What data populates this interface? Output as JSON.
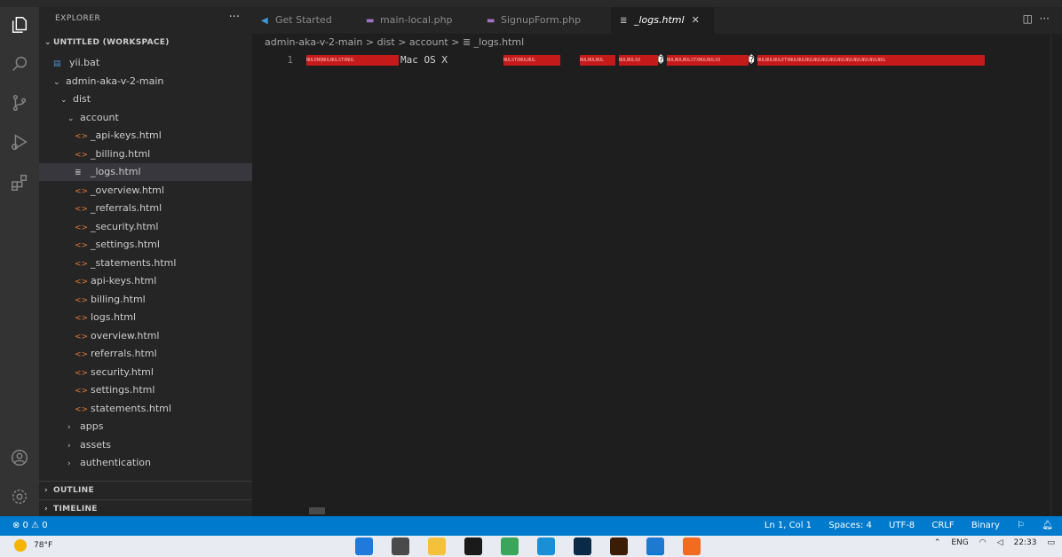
{
  "sidebar": {
    "title": "EXPLORER",
    "more": "···",
    "workspace": "UNTITLED (WORKSPACE)",
    "items": [
      {
        "label": "yii.bat",
        "type": "file",
        "icon": "bat-file-icon",
        "color": "#4d8fcf"
      },
      {
        "label": "admin-aka-v-2-main",
        "type": "folder-open"
      },
      {
        "label": "dist",
        "type": "folder-open"
      },
      {
        "label": "account",
        "type": "folder-open"
      },
      {
        "label": "_api-keys.html",
        "type": "file",
        "icon": "html-file-icon",
        "color": "#e37933"
      },
      {
        "label": "_billing.html",
        "type": "file",
        "icon": "html-file-icon",
        "color": "#e37933"
      },
      {
        "label": "_logs.html",
        "type": "file",
        "icon": "binary-file-icon",
        "color": "#cccccc",
        "selected": true
      },
      {
        "label": "_overview.html",
        "type": "file",
        "icon": "html-file-icon",
        "color": "#e37933"
      },
      {
        "label": "_referrals.html",
        "type": "file",
        "icon": "html-file-icon",
        "color": "#e37933"
      },
      {
        "label": "_security.html",
        "type": "file",
        "icon": "html-file-icon",
        "color": "#e37933"
      },
      {
        "label": "_settings.html",
        "type": "file",
        "icon": "html-file-icon",
        "color": "#e37933"
      },
      {
        "label": "_statements.html",
        "type": "file",
        "icon": "html-file-icon",
        "color": "#e37933"
      },
      {
        "label": "api-keys.html",
        "type": "file",
        "icon": "html-file-icon",
        "color": "#e37933"
      },
      {
        "label": "billing.html",
        "type": "file",
        "icon": "html-file-icon",
        "color": "#e37933"
      },
      {
        "label": "logs.html",
        "type": "file",
        "icon": "html-file-icon",
        "color": "#e37933"
      },
      {
        "label": "overview.html",
        "type": "file",
        "icon": "html-file-icon",
        "color": "#e37933"
      },
      {
        "label": "referrals.html",
        "type": "file",
        "icon": "html-file-icon",
        "color": "#e37933"
      },
      {
        "label": "security.html",
        "type": "file",
        "icon": "html-file-icon",
        "color": "#e37933"
      },
      {
        "label": "settings.html",
        "type": "file",
        "icon": "html-file-icon",
        "color": "#e37933"
      },
      {
        "label": "statements.html",
        "type": "file",
        "icon": "html-file-icon",
        "color": "#e37933"
      },
      {
        "label": "apps",
        "type": "folder-closed"
      },
      {
        "label": "assets",
        "type": "folder-closed"
      },
      {
        "label": "authentication",
        "type": "folder-closed"
      }
    ],
    "outline": "OUTLINE",
    "timeline": "TIMELINE"
  },
  "tabs": [
    {
      "label": "Get Started",
      "icon": "vscode-icon",
      "color": "#3c99dc"
    },
    {
      "label": "main-local.php",
      "icon": "php-file-icon",
      "color": "#a074c4"
    },
    {
      "label": "SignupForm.php",
      "icon": "php-file-icon",
      "color": "#a074c4"
    },
    {
      "label": "_logs.html",
      "icon": "binary-file-icon",
      "color": "#cccccc",
      "active": true,
      "close": "✕"
    }
  ],
  "breadcrumb": "admin-aka-v-2-main > dist > account > ≣ _logs.html",
  "editor": {
    "line_number": "1",
    "visible_text": "Mac OS X",
    "replacement_char_1": "�",
    "replacement_char_2": "�",
    "control_blocks": [
      "NULENQNULNULSTXNUL",
      "NULSTXNULNUL",
      "NULNULNUL",
      "NULNULSO",
      "NULNULNULSTXNULNULSO",
      "NULNULNULETXNULNULNULNULNULNULNULNULNULNULNULNUL"
    ],
    "control_color": "#c41a1a"
  },
  "status": {
    "left": "⊗ 0 ⚠ 0",
    "position": "Ln 1, Col 1",
    "spaces": "Spaces: 4",
    "encoding": "UTF-8",
    "eol": "CRLF",
    "language": "Binary",
    "bar_color": "#007acc"
  },
  "taskbar": {
    "weather": "78°F",
    "time": "22:33",
    "lang": "ENG",
    "apps": [
      {
        "icon": "windows-start-icon",
        "color": "#1f7adb"
      },
      {
        "icon": "task-view-icon",
        "color": "#4a4a4a"
      },
      {
        "icon": "file-explorer-icon",
        "color": "#f3c13a"
      },
      {
        "icon": "terminal-app-icon",
        "color": "#1a1a1a"
      },
      {
        "icon": "chrome-icon",
        "color": "#3ba55c"
      },
      {
        "icon": "edge-icon",
        "color": "#1a8fd6"
      },
      {
        "icon": "photoshop-icon",
        "color": "#0b2a47"
      },
      {
        "icon": "illustrator-icon",
        "color": "#3b1c05"
      },
      {
        "icon": "vscode-taskbar-icon",
        "color": "#1e7ad1",
        "active": true
      },
      {
        "icon": "xampp-icon",
        "color": "#f26b21"
      }
    ]
  }
}
